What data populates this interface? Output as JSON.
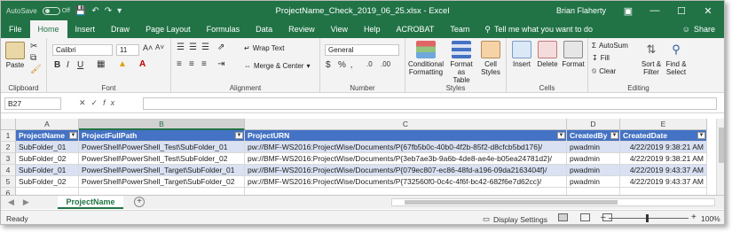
{
  "titlebar": {
    "autosave_label": "AutoSave",
    "autosave_state": "Off",
    "title": "ProjectName_Check_2019_06_25.xlsx  -  Excel",
    "user": "Brian Flaherty"
  },
  "tabs": [
    "File",
    "Home",
    "Insert",
    "Draw",
    "Page Layout",
    "Formulas",
    "Data",
    "Review",
    "View",
    "Help",
    "ACROBAT",
    "Team"
  ],
  "active_tab": "Home",
  "tell_me": "Tell me what you want to do",
  "share": "Share",
  "ribbon": {
    "clipboard": {
      "label": "Clipboard",
      "paste": "Paste"
    },
    "font": {
      "label": "Font",
      "name": "Calibri",
      "size": "11"
    },
    "alignment": {
      "label": "Alignment",
      "wrap": "Wrap Text",
      "merge": "Merge & Center"
    },
    "number": {
      "label": "Number",
      "format": "General"
    },
    "styles": {
      "label": "Styles",
      "conditional": "Conditional",
      "conditional2": "Formatting",
      "format_table": "Format as",
      "format_table2": "Table",
      "cell_styles": "Cell",
      "cell_styles2": "Styles"
    },
    "cells": {
      "label": "Cells",
      "insert": "Insert",
      "delete": "Delete",
      "format": "Format"
    },
    "editing": {
      "label": "Editing",
      "autosum": "AutoSum",
      "fill": "Fill",
      "clear": "Clear",
      "sort": "Sort &",
      "sort2": "Filter",
      "find": "Find &",
      "find2": "Select"
    }
  },
  "formula_bar": {
    "name_box": "B27",
    "fx": "fx",
    "content": ""
  },
  "columns": [
    {
      "letter": "A",
      "selected": false
    },
    {
      "letter": "B",
      "selected": true
    },
    {
      "letter": "C",
      "selected": false
    },
    {
      "letter": "D",
      "selected": false
    },
    {
      "letter": "E",
      "selected": false
    }
  ],
  "table": {
    "headers": [
      "ProjectName",
      "ProjectFullPath",
      "ProjectURN",
      "CreatedBy",
      "CreatedDate"
    ],
    "rows": [
      [
        "SubFolder_01",
        "PowerShell\\PowerShell_Test\\SubFolder_01",
        "pw://BMF-WS2016:ProjectWise/Documents/P{67fb5b0c-40b0-4f2b-85f2-d8cfcb5bd176}/",
        "pwadmin",
        "4/22/2019 9:38:21 AM"
      ],
      [
        "SubFolder_02",
        "PowerShell\\PowerShell_Test\\SubFolder_02",
        "pw://BMF-WS2016:ProjectWise/Documents/P{3eb7ae3b-9a6b-4de8-ae4e-b05ea24781d2}/",
        "pwadmin",
        "4/22/2019 9:38:21 AM"
      ],
      [
        "SubFolder_01",
        "PowerShell\\PowerShell_Target\\SubFolder_01",
        "pw://BMF-WS2016:ProjectWise/Documents/P{079ec807-ec86-48fd-a196-09da2163404f}/",
        "pwadmin",
        "4/22/2019 9:43:37 AM"
      ],
      [
        "SubFolder_02",
        "PowerShell\\PowerShell_Target\\SubFolder_02",
        "pw://BMF-WS2016:ProjectWise/Documents/P{732560f0-0c4c-4f6f-bc42-682f6e7d62cc}/",
        "pwadmin",
        "4/22/2019 9:43:37 AM"
      ]
    ],
    "row_numbers": [
      "1",
      "2",
      "3",
      "4",
      "5",
      "6"
    ]
  },
  "sheet_tab": "ProjectName",
  "status": {
    "ready": "Ready",
    "display_settings": "Display Settings",
    "zoom": "100%"
  },
  "colors": {
    "excel_green": "#217346",
    "table_header": "#4472c4",
    "table_band": "#d9e1f2"
  }
}
